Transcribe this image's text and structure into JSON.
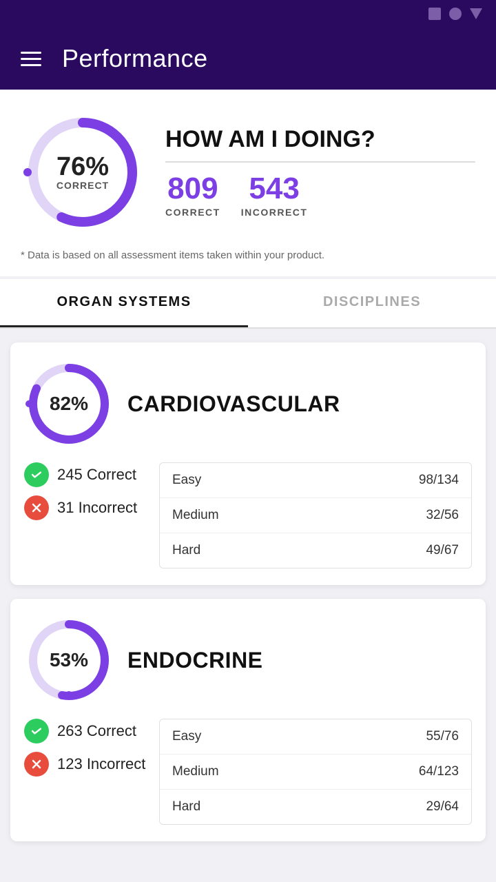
{
  "statusBar": {
    "icons": [
      "square",
      "circle",
      "triangle"
    ]
  },
  "header": {
    "title": "Performance",
    "menu_label": "menu"
  },
  "summary": {
    "donut": {
      "percent": "76%",
      "label": "CORRECT",
      "value": 76,
      "color": "#7b3fe4",
      "trackColor": "#e0d4f7"
    },
    "heading": "HOW AM I DOING?",
    "correct": {
      "value": "809",
      "label": "CORRECT"
    },
    "incorrect": {
      "value": "543",
      "label": "INCORRECT"
    },
    "disclaimer": "* Data is based on all assessment items taken within your product."
  },
  "tabs": [
    {
      "id": "organ-systems",
      "label": "ORGAN SYSTEMS",
      "active": true
    },
    {
      "id": "disciplines",
      "label": "DISCIPLINES",
      "active": false
    }
  ],
  "cards": [
    {
      "id": "cardiovascular",
      "title": "CARDIOVASCULAR",
      "percent": "82%",
      "percentValue": 82,
      "correct": "245 Correct",
      "incorrect": "31 Incorrect",
      "difficulty": [
        {
          "label": "Easy",
          "value": "98/134"
        },
        {
          "label": "Medium",
          "value": "32/56"
        },
        {
          "label": "Hard",
          "value": "49/67"
        }
      ]
    },
    {
      "id": "endocrine",
      "title": "ENDOCRINE",
      "percent": "53%",
      "percentValue": 53,
      "correct": "263 Correct",
      "incorrect": "123 Incorrect",
      "difficulty": [
        {
          "label": "Easy",
          "value": "55/76"
        },
        {
          "label": "Medium",
          "value": "64/123"
        },
        {
          "label": "Hard",
          "value": "29/64"
        }
      ]
    }
  ]
}
